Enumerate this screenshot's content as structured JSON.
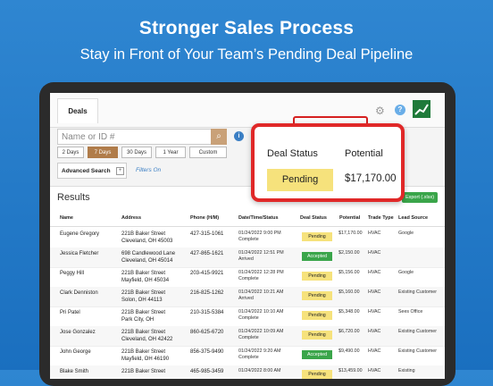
{
  "hero": {
    "title": "Stronger Sales Process",
    "subtitle": "Stay in Front of Your Team’s Pending Deal Pipeline"
  },
  "app": {
    "tab": "Deals",
    "search_placeholder": "Name or ID #",
    "date_filters": [
      "2 Days",
      "7 Days",
      "30 Days",
      "1 Year",
      "Custom"
    ],
    "active_filter": "7 Days",
    "advanced_search": "Advanced Search",
    "filters_on": "Filters On",
    "results_title": "Results",
    "export_label": "Export (.xlsx)"
  },
  "table": {
    "headers": [
      "Name",
      "Address",
      "Phone (H/M)",
      "Date/Time/Status",
      "Deal Status",
      "Potential",
      "Trade Type",
      "Lead Source"
    ],
    "rows": [
      {
        "name": "Eugene Gregory",
        "addr1": "221B Baker Street",
        "addr2": "Cleveland, OH 45003",
        "phone": "427-315-1061",
        "date": "01/24/2022 9:00 PM",
        "status": "Complete",
        "deal": "Pending",
        "potential": "$17,170.00",
        "trade": "HVAC",
        "source": "Google"
      },
      {
        "name": "Jessica Fletcher",
        "addr1": "698 Candlewood Lane",
        "addr2": "Cleveland, OH 45014",
        "phone": "427-865-1621",
        "date": "01/24/2022 12:51 PM",
        "status": "Arrived",
        "deal": "Accepted",
        "potential": "$2,150.00",
        "trade": "HVAC",
        "source": ""
      },
      {
        "name": "Peggy Hill",
        "addr1": "221B Baker Street",
        "addr2": "Mayfield, OH 45034",
        "phone": "203-415-9921",
        "date": "01/24/2022 12:28 PM",
        "status": "Complete",
        "deal": "Pending",
        "potential": "$5,156.00",
        "trade": "HVAC",
        "source": "Google"
      },
      {
        "name": "Clark Denniston",
        "addr1": "221B Baker Street",
        "addr2": "Solon, OH 44113",
        "phone": "216-825-1262",
        "date": "01/24/2022 10:21 AM",
        "status": "Arrived",
        "deal": "Pending",
        "potential": "$5,160.00",
        "trade": "HVAC",
        "source": "Existing Customer"
      },
      {
        "name": "Pri Patel",
        "addr1": "221B Baker Street",
        "addr2": "Park City, OH",
        "phone": "210-315-5384",
        "date": "01/24/2022 10:10 AM",
        "status": "Complete",
        "deal": "Pending",
        "potential": "$5,348.00",
        "trade": "HVAC",
        "source": "Sees Office"
      },
      {
        "name": "Jose Gonzalez",
        "addr1": "221B Baker Street",
        "addr2": "Cleveland, OH 42422",
        "phone": "860-625-6720",
        "date": "01/24/2022 10:09 AM",
        "status": "Complete",
        "deal": "Pending",
        "potential": "$6,720.00",
        "trade": "HVAC",
        "source": "Existing Customer"
      },
      {
        "name": "John George",
        "addr1": "221B Baker Street",
        "addr2": "Mayfield, OH 46190",
        "phone": "856-375-9490",
        "date": "01/24/2022 9:20 AM",
        "status": "Complete",
        "deal": "Accepted",
        "potential": "$9,490.00",
        "trade": "HVAC",
        "source": "Existing Customer"
      },
      {
        "name": "Blake Smith",
        "addr1": "221B Baker Street",
        "addr2": "",
        "phone": "465-985-3459",
        "date": "01/24/2022 8:00 AM",
        "status": "",
        "deal": "Pending",
        "potential": "$13,459.00",
        "trade": "HVAC",
        "source": "Existing"
      }
    ]
  },
  "callout": {
    "deal_status_label": "Deal Status",
    "potential_label": "Potential",
    "deal_status_value": "Pending",
    "potential_value": "$17,170.00"
  },
  "colors": {
    "background": "#2478c8",
    "pending": "#f6e27c",
    "accepted": "#3aa54a",
    "highlight": "#e02828",
    "active_filter": "#b07c4a"
  }
}
